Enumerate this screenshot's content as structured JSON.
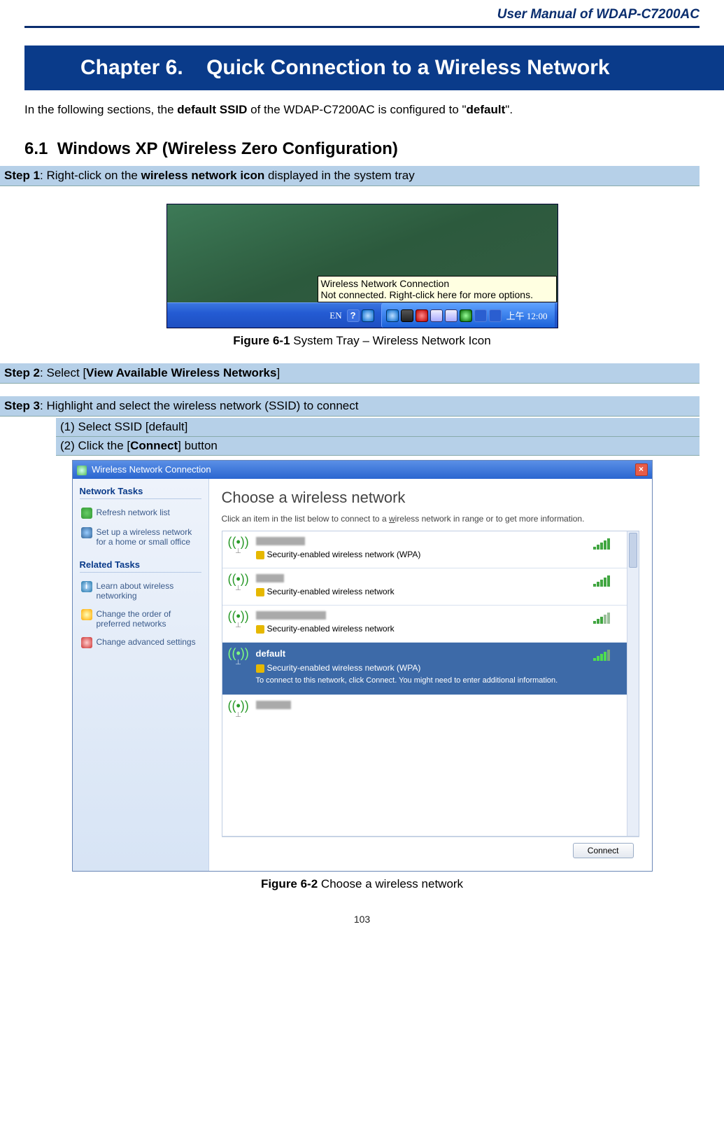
{
  "header": {
    "manual_title": "User Manual of WDAP-C7200AC"
  },
  "chapter": {
    "number": "Chapter 6.",
    "title": "Quick Connection to a Wireless Network"
  },
  "intro": {
    "prefix": "In the following sections, the ",
    "bold1": "default SSID",
    "mid": " of the WDAP-C7200AC is configured to \"",
    "bold2": "default",
    "suffix": "\"."
  },
  "section61": {
    "num": "6.1",
    "title": "Windows XP (Wireless Zero Configuration)"
  },
  "step1": {
    "label": "Step 1",
    "sep": ": Right-click on the ",
    "bold": "wireless network icon",
    "after": " displayed in the system tray"
  },
  "tray": {
    "tooltip_l1": "Wireless Network Connection",
    "tooltip_l2": "Not connected. Right-click here for more options.",
    "lang": "EN",
    "help": "?",
    "clock": "上午 12:00"
  },
  "fig61": {
    "bold": "Figure 6-1",
    "rest": " System Tray – Wireless Network Icon"
  },
  "step2": {
    "label": "Step 2",
    "sep": ": Select [",
    "bold": "View Available Wireless Networks",
    "after": "]"
  },
  "step3": {
    "label": "Step 3",
    "rest": ": Highlight and select the wireless network (SSID) to connect",
    "sub1": "(1)  Select SSID [default]",
    "sub2a": "(2)  Click the [",
    "sub2b": "Connect",
    "sub2c": "] button"
  },
  "dialog": {
    "title": "Wireless Network Connection",
    "close_x": "×",
    "side": {
      "h1": "Network Tasks",
      "refresh": "Refresh network list",
      "setup": "Set up a wireless network for a home or small office",
      "h2": "Related Tasks",
      "learn": "Learn about wireless networking",
      "order": "Change the order of preferred networks",
      "adv": "Change advanced settings",
      "info_glyph": "i"
    },
    "main": {
      "heading": "Choose a wireless network",
      "sub_a": "Click an item in the list below to connect to a ",
      "sub_u": "w",
      "sub_b": "ireless network in range or to get more information.",
      "sec_wpa": "Security-enabled wireless network (WPA)",
      "sec": "Security-enabled wireless network",
      "sel_name": "default",
      "sel_sec": "Security-enabled wireless network (WPA)",
      "sel_desc": "To connect to this network, click Connect. You might need to enter additional information.",
      "connect": "Connect"
    }
  },
  "fig62": {
    "bold": "Figure 6-2",
    "rest": " Choose a wireless network"
  },
  "page_number": "103"
}
